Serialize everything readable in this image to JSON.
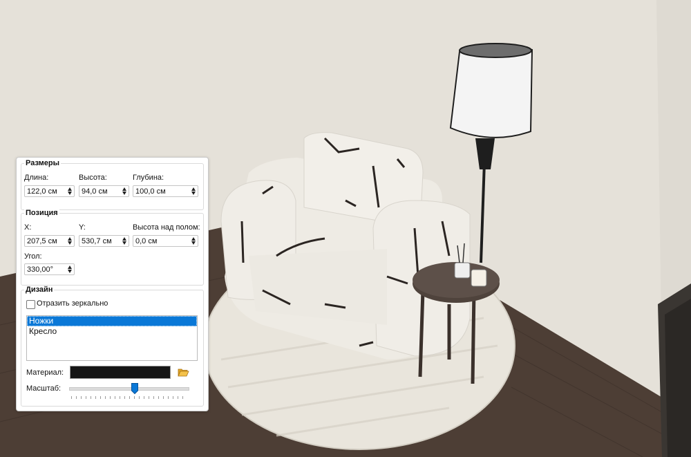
{
  "panel": {
    "sizes": {
      "title": "Размеры",
      "length_label": "Длина:",
      "length_value": "122,0 см",
      "height_label": "Высота:",
      "height_value": "94,0 см",
      "depth_label": "Глубина:",
      "depth_value": "100,0 см"
    },
    "position": {
      "title": "Позиция",
      "x_label": "X:",
      "x_value": "207,5 см",
      "y_label": "Y:",
      "y_value": "530,7 см",
      "elevation_label": "Высота над полом:",
      "elevation_value": "0,0 см",
      "angle_label": "Угол:",
      "angle_value": "330,00°"
    },
    "design": {
      "title": "Дизайн",
      "mirror_label": "Отразить зеркально",
      "mirror_checked": false,
      "parts": [
        "Ножки",
        "Кресло"
      ],
      "selected_part": "Ножки",
      "material_label": "Материал:",
      "material_color": "#151515",
      "scale_label": "Масштаб:",
      "scale_level": 0.55
    }
  },
  "colors": {
    "selection": "#0a78d7",
    "wall": "#e4e0d8",
    "floor": "#4e3f36"
  }
}
